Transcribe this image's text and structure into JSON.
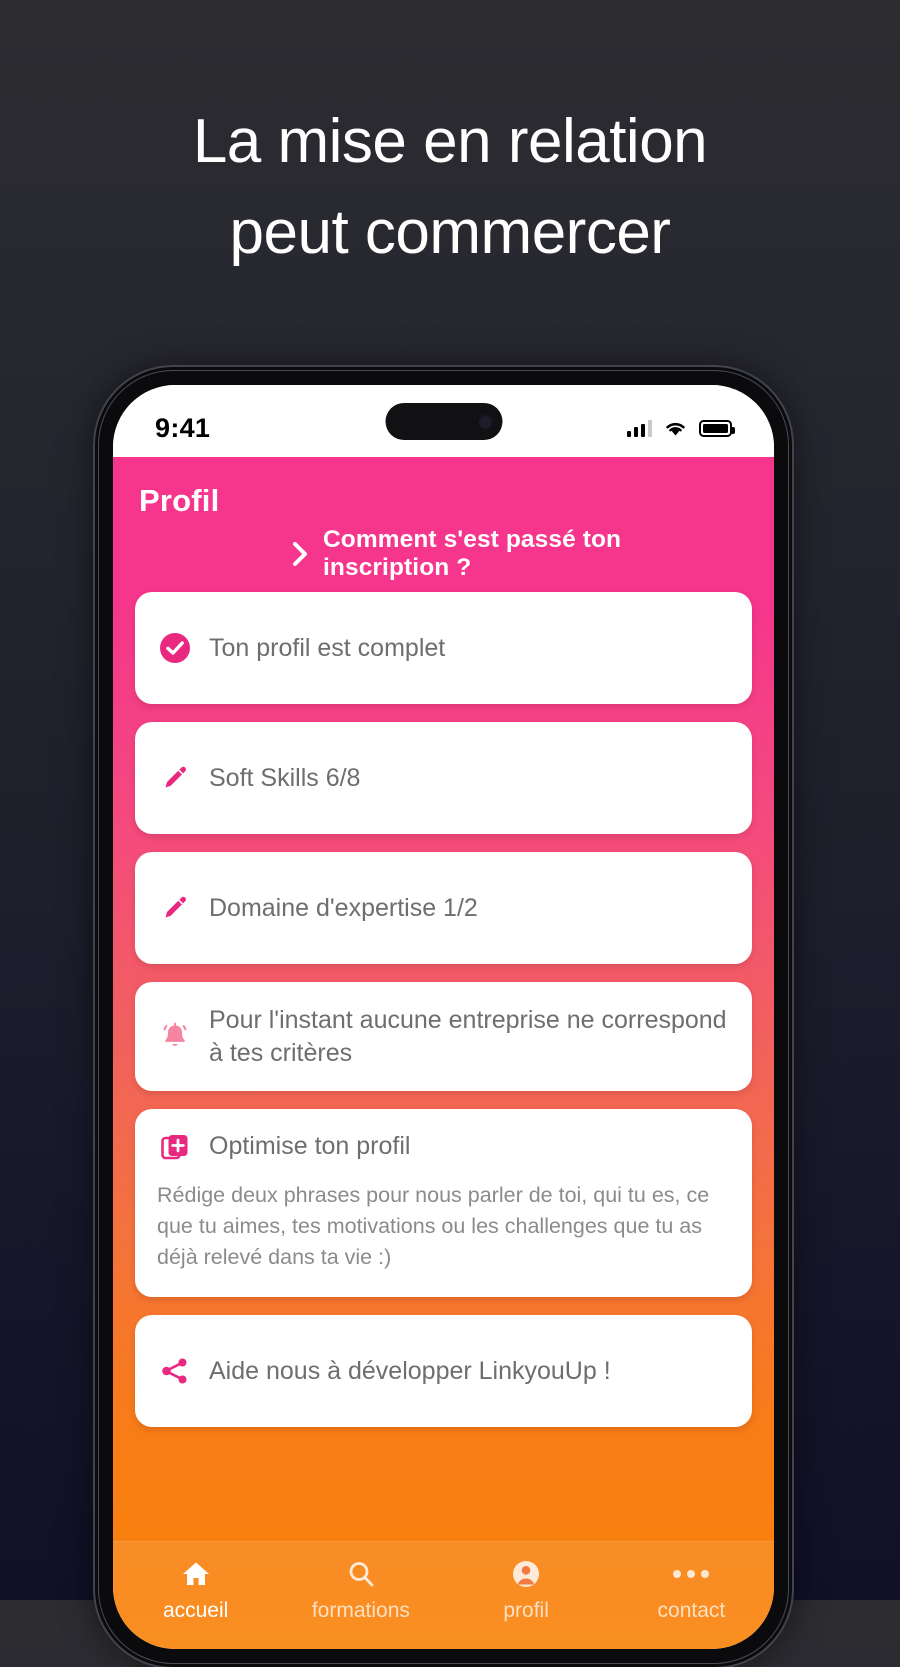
{
  "headline": {
    "line1": "La mise en relation",
    "line2": "peut commercer"
  },
  "colors": {
    "pink": "#f5368c",
    "orange": "#f98207",
    "icon_pink": "#e8297f",
    "bell_pink": "#f4849f",
    "card_text": "#6e6e6e",
    "page_bg_top": "#2c2c31",
    "page_bg_bottom": "#101027"
  },
  "status_bar": {
    "time": "9:41",
    "signal_icon": "cellular-bars-icon",
    "wifi_icon": "wifi-icon",
    "battery_icon": "battery-icon"
  },
  "app": {
    "title": "Profil",
    "inscription_link": "Comment s'est passé ton inscription ?",
    "inscription_chevron_icon": "chevron-right-icon",
    "cards": [
      {
        "icon": "check-circle-icon",
        "text": "Ton profil est complet"
      },
      {
        "icon": "pencil-icon",
        "text": "Soft Skills 6/8"
      },
      {
        "icon": "pencil-icon",
        "text": "Domaine d'expertise 1/2"
      },
      {
        "icon": "bell-icon",
        "text": "Pour l'instant aucune entreprise ne correspond à tes critères"
      }
    ],
    "optimise_card": {
      "icon": "library-add-icon",
      "title": "Optimise ton profil",
      "body": "Rédige deux phrases pour nous parler de toi, qui tu es, ce que tu aimes, tes motivations ou les challenges que tu as déjà relevé dans ta vie :)"
    },
    "share_card": {
      "icon": "share-icon",
      "text": "Aide nous à développer LinkyouUp !"
    },
    "nav": [
      {
        "icon": "home-icon",
        "label": "accueil",
        "active": true
      },
      {
        "icon": "search-icon",
        "label": "formations",
        "active": false
      },
      {
        "icon": "person-icon",
        "label": "profil",
        "active": false
      },
      {
        "icon": "ellipsis-icon",
        "label": "contact",
        "active": false
      }
    ]
  }
}
